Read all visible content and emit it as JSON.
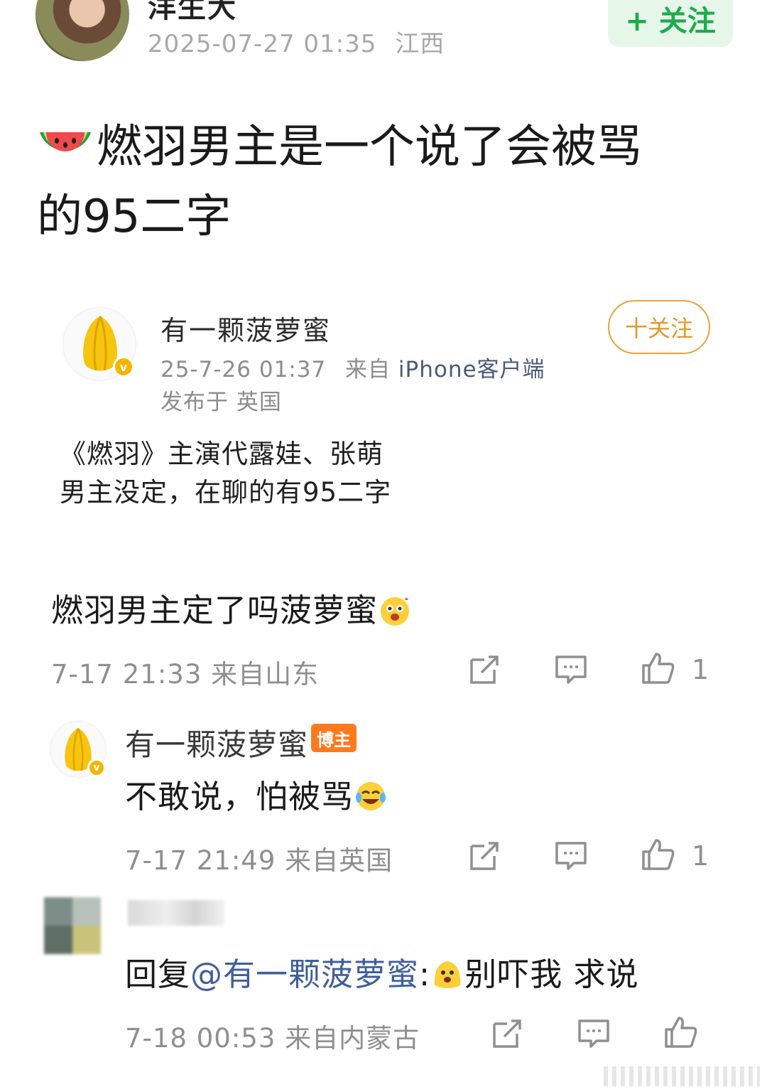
{
  "header": {
    "username": "洋生大",
    "timestamp": "2025-07-27 01:35",
    "location": "江西",
    "follow_label": "+ 关注"
  },
  "post": {
    "title_line1": "燃羽男主是一个说了会被骂",
    "title_line2": "的95二字",
    "title_emoji": "watermelon-icon"
  },
  "quoted": {
    "username": "有一颗菠萝蜜",
    "meta_date": "25-7-26 01:37",
    "meta_from": "来自",
    "meta_source": "iPhone客户端",
    "location": "发布于 英国",
    "follow_label": "十关注",
    "body_line1": "《燃羽》主演代露娃、张萌",
    "body_line2": "男主没定，在聊的有95二字"
  },
  "comments": [
    {
      "text": "燃羽男主定了吗菠萝蜜",
      "emoji": "excited-face-icon",
      "meta": "7-17 21:33  来自山东",
      "likes": "1"
    },
    {
      "author": "有一颗菠萝蜜",
      "badge": "博主",
      "text": "不敢说，怕被骂",
      "emoji": "tears-of-joy-icon",
      "meta": "7-17 21:49  来自英国",
      "likes": "1"
    },
    {
      "reply_prefix": "回复",
      "mention": "@有一颗菠萝蜜",
      "separator": ":",
      "emoji": "scared-face-icon",
      "text": "别吓我 求说",
      "meta": "7-18 00:53  来自内蒙古"
    }
  ],
  "colors": {
    "follow_green": "#1dab4e",
    "follow_orange": "#e39a28",
    "mention_blue": "#3f5f99",
    "badge_orange": "#ff7a1f",
    "meta_gray": "#8f8f8f"
  }
}
